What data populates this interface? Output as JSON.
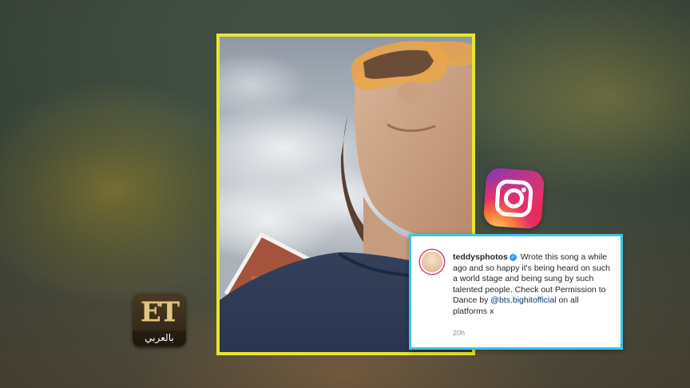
{
  "post": {
    "username": "teddysphotos",
    "caption_text": "Wrote this song a while ago and so happy it's being heard on such a world stage and being sung by such talented people. Check out Permission to Dance by ",
    "mention": "@bts.bighitofficial",
    "caption_end": " on all platforms x",
    "timestamp": "20h"
  },
  "brand": {
    "letters": "ET",
    "arabic": "بالعربي"
  },
  "colors": {
    "frame_border": "#e8e62c",
    "card_border": "#39c6dd",
    "verified_badge": "#3897f0"
  },
  "icons": {
    "platform": "instagram-icon",
    "verified": "verified-badge-icon"
  }
}
